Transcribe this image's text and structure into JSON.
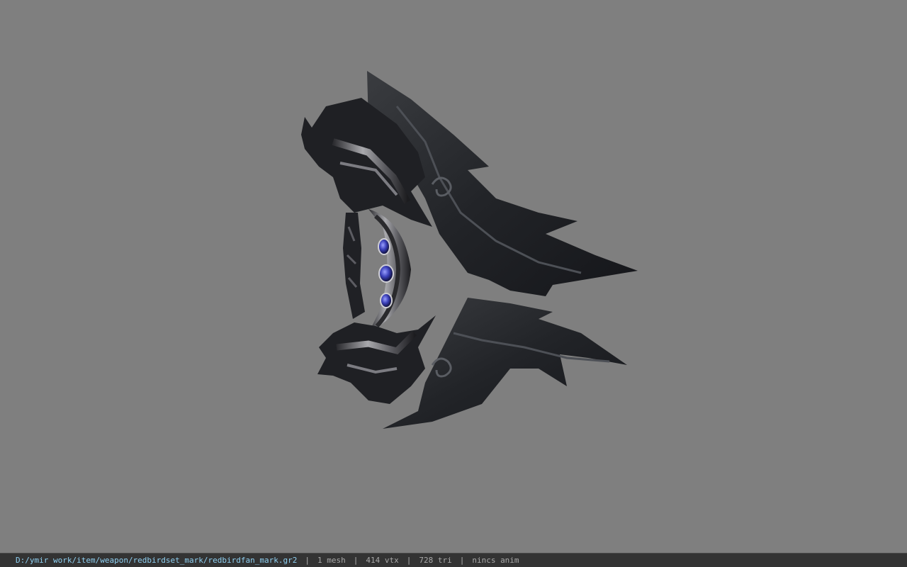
{
  "viewer": {
    "background_color": "#7f7f7f",
    "model_name": "redbirdfan_mark"
  },
  "statusbar": {
    "file_path": "D:/ymir work/item/weapon/redbirdset_mark/redbirdfan_mark.gr2",
    "separator": "|",
    "mesh_count": "1 mesh",
    "vertex_count": "414 vtx",
    "triangle_count": "728 tri",
    "animation": "nincs anim",
    "path_color": "#8fd0f2"
  }
}
